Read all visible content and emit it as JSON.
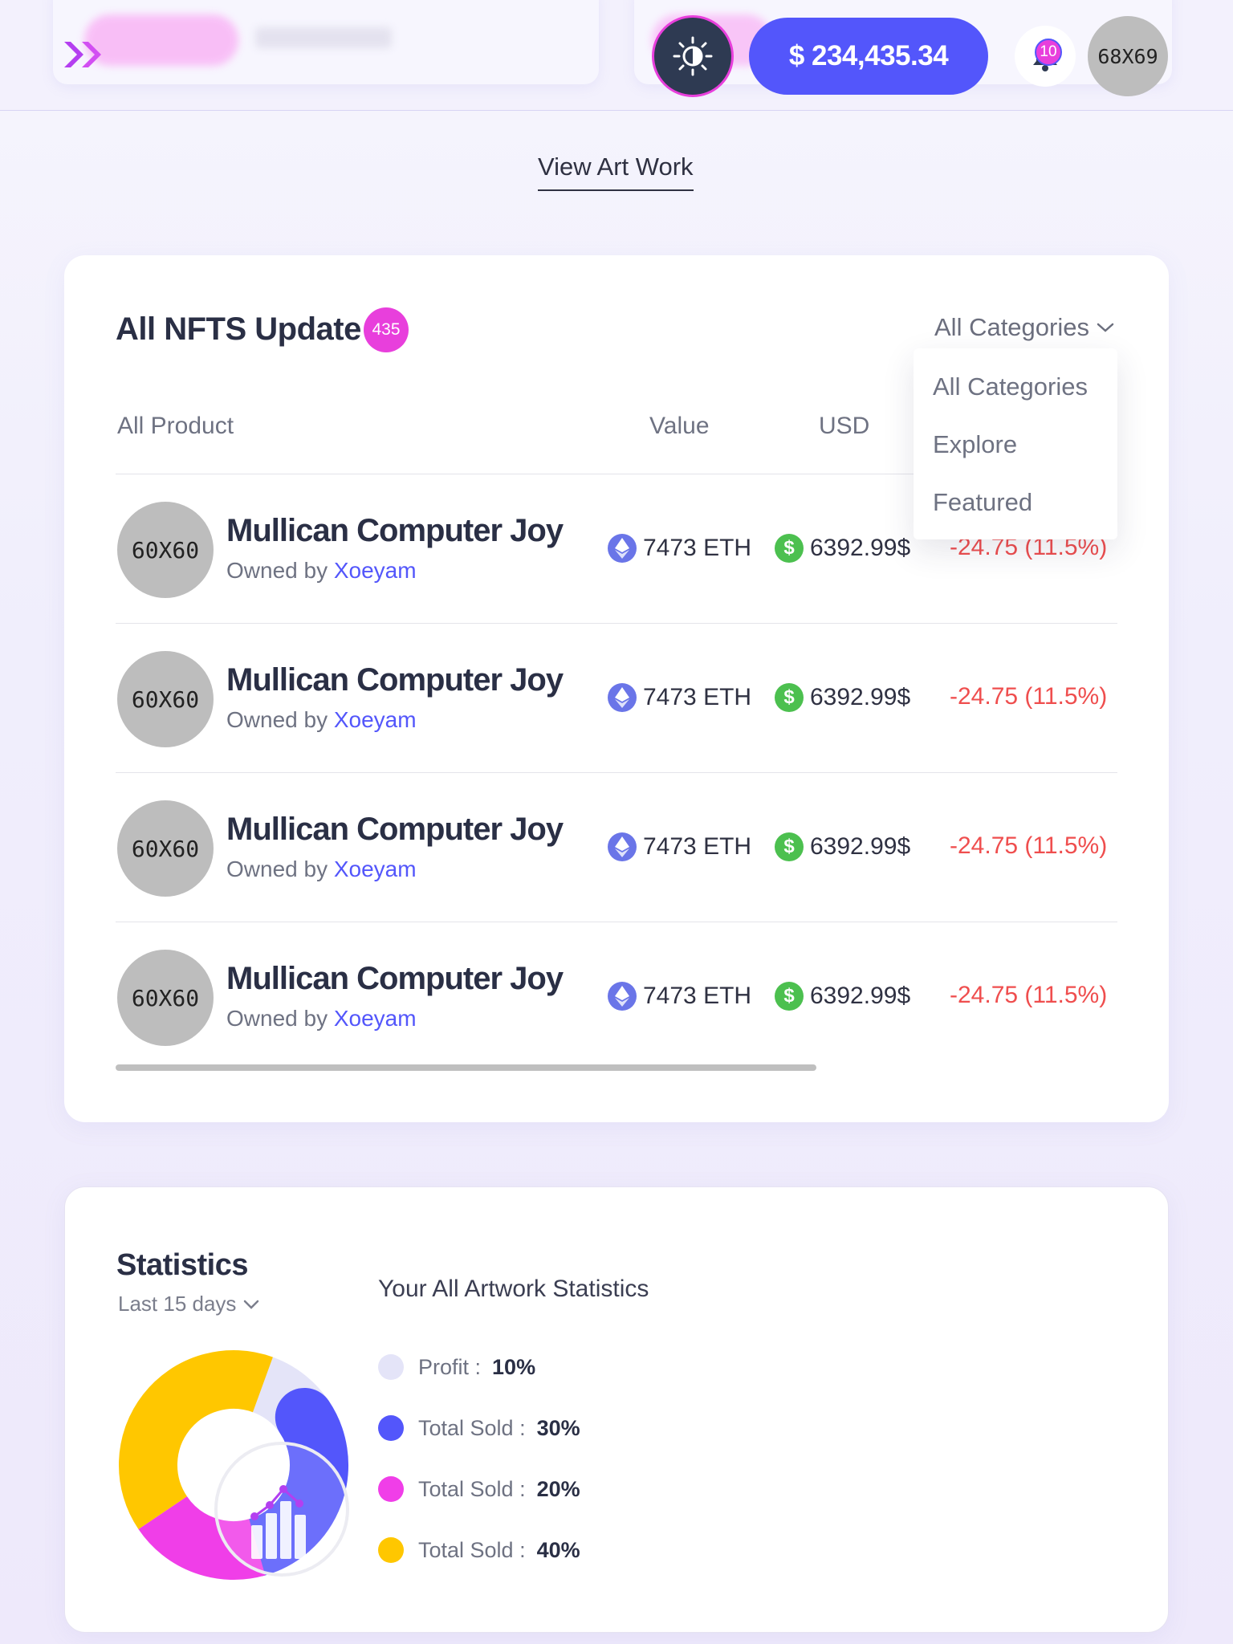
{
  "header": {
    "balance": "$ 234,435.34",
    "notification_count": "10",
    "avatar_label": "68X69"
  },
  "view_art_work": "View Art Work",
  "nft_card": {
    "title": "All NFTS Update",
    "count": "435",
    "category_select": "All Categories",
    "columns": [
      "All Product",
      "Value",
      "USD"
    ],
    "dropdown_options": [
      "All Categories",
      "Explore",
      "Featured"
    ],
    "rows": [
      {
        "thumb": "60X60",
        "name": "Mullican Computer Joy",
        "owned_prefix": "Owned by ",
        "owner": "Xoeyam",
        "eth": "7473 ETH",
        "usd": "6392.99$",
        "change": "-24.75 (11.5%)"
      },
      {
        "thumb": "60X60",
        "name": "Mullican Computer Joy",
        "owned_prefix": "Owned by ",
        "owner": "Xoeyam",
        "eth": "7473 ETH",
        "usd": "6392.99$",
        "change": "-24.75 (11.5%)"
      },
      {
        "thumb": "60X60",
        "name": "Mullican Computer Joy",
        "owned_prefix": "Owned by ",
        "owner": "Xoeyam",
        "eth": "7473 ETH",
        "usd": "6392.99$",
        "change": "-24.75 (11.5%)"
      },
      {
        "thumb": "60X60",
        "name": "Mullican Computer Joy",
        "owned_prefix": "Owned by ",
        "owner": "Xoeyam",
        "eth": "7473 ETH",
        "usd": "6392.99$",
        "change": "-24.75 (11.5%)"
      }
    ]
  },
  "statistics": {
    "title": "Statistics",
    "range": "Last 15 days",
    "subtitle": "Your All Artwork Statistics",
    "legend": [
      {
        "label": "Profit :",
        "value": "10%",
        "color": "#e4e4f8"
      },
      {
        "label": "Total Sold :",
        "value": "30%",
        "color": "#5356fb"
      },
      {
        "label": "Total Sold :",
        "value": "20%",
        "color": "#f03ee8"
      },
      {
        "label": "Total Sold :",
        "value": "40%",
        "color": "#ffc700"
      }
    ]
  },
  "chart_data": {
    "type": "pie",
    "categories": [
      "Profit",
      "Total Sold",
      "Total Sold",
      "Total Sold"
    ],
    "values": [
      10,
      30,
      20,
      40
    ],
    "colors": [
      "#e4e4f8",
      "#5356fb",
      "#f03ee8",
      "#ffc700"
    ]
  }
}
